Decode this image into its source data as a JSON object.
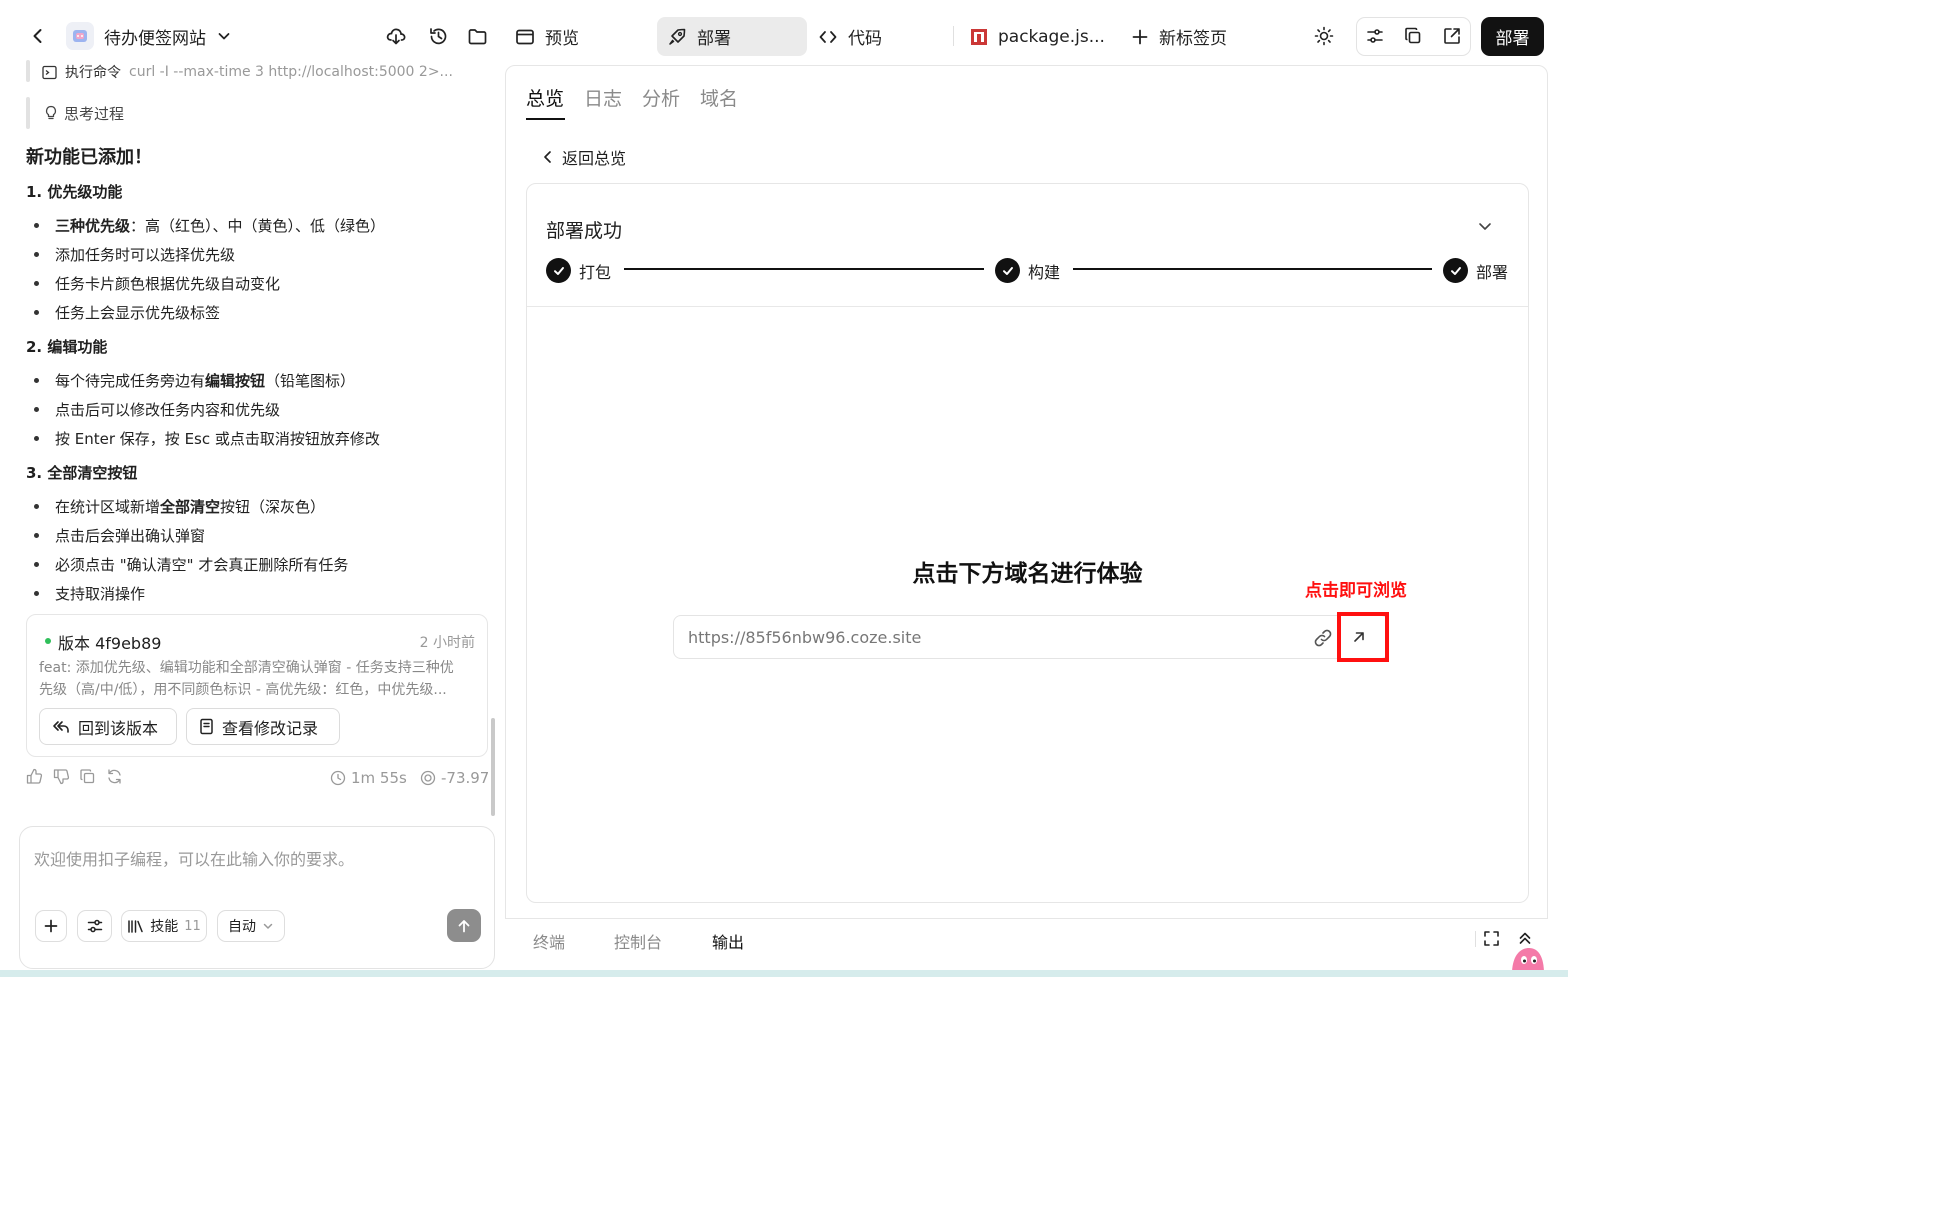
{
  "topbar": {
    "app_name": "待办便签网站",
    "tabs": [
      {
        "label": "预览"
      },
      {
        "label": "部署",
        "active": true
      },
      {
        "label": "代码"
      },
      {
        "label": "package.js..."
      },
      {
        "label": "新标签页"
      }
    ],
    "deploy_button": "部署"
  },
  "chat": {
    "cmd_prefix": "执行命令",
    "cmd_text": "curl -I --max-time 3 http://localhost:5000 2>...",
    "thinking": "思考过程",
    "title": "新功能已添加！",
    "sections": [
      {
        "heading": "1. 优先级功能",
        "items": [
          {
            "bold": "三种优先级",
            "text": "：高（红色）、中（黄色）、低（绿色）"
          },
          {
            "bold": "",
            "text": "添加任务时可以选择优先级"
          },
          {
            "bold": "",
            "text": "任务卡片颜色根据优先级自动变化"
          },
          {
            "bold": "",
            "text": "任务上会显示优先级标签"
          }
        ]
      },
      {
        "heading": "2. 编辑功能",
        "items": [
          {
            "pre": "每个待完成任务旁边有",
            "bold": "编辑按钮",
            "text": "（铅笔图标）"
          },
          {
            "bold": "",
            "text": "点击后可以修改任务内容和优先级"
          },
          {
            "bold": "",
            "text": "按 Enter 保存，按 Esc 或点击取消按钮放弃修改"
          }
        ]
      },
      {
        "heading": "3. 全部清空按钮",
        "items": [
          {
            "pre": "在统计区域新增",
            "bold": "全部清空",
            "text": "按钮（深灰色）"
          },
          {
            "bold": "",
            "text": "点击后会弹出确认弹窗"
          },
          {
            "bold": "",
            "text": "必须点击 \"确认清空\" 才会真正删除所有任务"
          },
          {
            "bold": "",
            "text": "支持取消操作"
          }
        ]
      }
    ],
    "version": {
      "label": "版本 4f9eb89",
      "time": "2 小时前",
      "desc_line1": "feat: 添加优先级、编辑功能和全部清空确认弹窗 - 任务支持三种优",
      "desc_line2": "先级（高/中/低），用不同颜色标识 - 高优先级：红色，中优先级...",
      "btn_revert": "回到该版本",
      "btn_history": "查看修改记录"
    },
    "meta": {
      "duration": "1m 55s",
      "credits": "-73.97"
    },
    "input": {
      "placeholder": "欢迎使用扣子编程，可以在此输入你的要求。",
      "skills_label": "技能",
      "skills_count": "11",
      "mode": "自动"
    }
  },
  "deploy_panel": {
    "tabs": [
      {
        "label": "总览",
        "active": true
      },
      {
        "label": "日志"
      },
      {
        "label": "分析"
      },
      {
        "label": "域名"
      }
    ],
    "back_label": "返回总览",
    "status_title": "部署成功",
    "steps": [
      {
        "label": "打包"
      },
      {
        "label": "构建"
      },
      {
        "label": "部署"
      }
    ],
    "experience_title": "点击下方域名进行体验",
    "annotation": "点击即可浏览",
    "url": "https://85f56nbw96.coze.site",
    "annotation_color": "#ff1010"
  },
  "bottom_tabs": [
    {
      "label": "终端"
    },
    {
      "label": "控制台"
    },
    {
      "label": "输出",
      "active": true
    }
  ]
}
